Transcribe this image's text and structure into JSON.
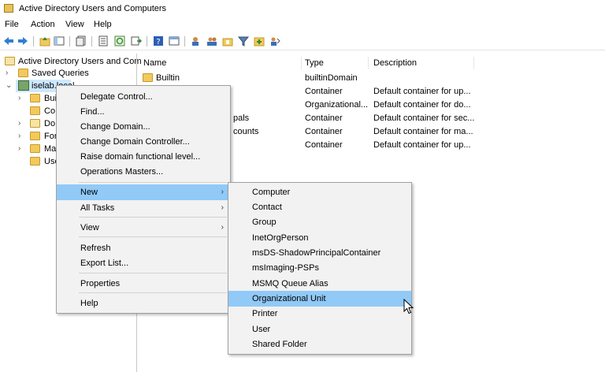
{
  "window": {
    "title": "Active Directory Users and Computers"
  },
  "menubar": {
    "file": "File",
    "action": "Action",
    "view": "View",
    "help": "Help"
  },
  "tree": {
    "root": "Active Directory Users and Com",
    "saved_queries": "Saved Queries",
    "domain": "iselab.local",
    "children_truncated": [
      "Bui",
      "Co",
      "Do",
      "For",
      "Ma",
      "Use"
    ]
  },
  "list": {
    "columns": {
      "name": "Name",
      "type": "Type",
      "description": "Description"
    },
    "rows": [
      {
        "name": "Builtin",
        "type": "builtinDomain",
        "description": ""
      },
      {
        "name": "",
        "type": "Container",
        "description": "Default container for up..."
      },
      {
        "name": "",
        "type": "Organizational...",
        "description": "Default container for do..."
      },
      {
        "name": "pals",
        "type": "Container",
        "description": "Default container for sec..."
      },
      {
        "name": "counts",
        "type": "Container",
        "description": "Default container for ma..."
      },
      {
        "name": "",
        "type": "Container",
        "description": "Default container for up..."
      }
    ]
  },
  "context_menu": {
    "delegate_control": "Delegate Control...",
    "find": "Find...",
    "change_domain": "Change Domain...",
    "change_domain_controller": "Change Domain Controller...",
    "raise_domain_level": "Raise domain functional level...",
    "operations_masters": "Operations Masters...",
    "new": "New",
    "all_tasks": "All Tasks",
    "view": "View",
    "refresh": "Refresh",
    "export_list": "Export List...",
    "properties": "Properties",
    "help": "Help"
  },
  "submenu": {
    "computer": "Computer",
    "contact": "Contact",
    "group": "Group",
    "inetorgperson": "InetOrgPerson",
    "shadow_principal": "msDS-ShadowPrincipalContainer",
    "msimaging": "msImaging-PSPs",
    "msmq": "MSMQ Queue Alias",
    "org_unit": "Organizational Unit",
    "printer": "Printer",
    "user": "User",
    "shared_folder": "Shared Folder"
  },
  "colors": {
    "highlight": "#91c9f7",
    "tree_selected": "#cde8ff",
    "menu_bg": "#f2f2f2"
  }
}
